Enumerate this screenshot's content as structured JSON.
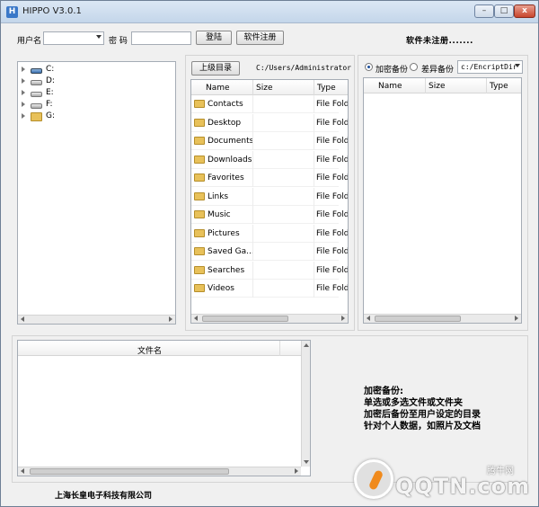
{
  "window": {
    "title": "HIPPO  V3.0.1",
    "buttons": {
      "min": "–",
      "max": "□",
      "close": "x"
    }
  },
  "toolbar": {
    "username_label": "用户名",
    "password_label": "密 码",
    "login_button": "登陆",
    "register_button": "软件注册",
    "status_text": "软件未注册......."
  },
  "drives": [
    {
      "label": "C:"
    },
    {
      "label": "D:"
    },
    {
      "label": "E:"
    },
    {
      "label": "F:"
    },
    {
      "label": "G:"
    }
  ],
  "browser": {
    "up_button": "上级目录",
    "path": "C:/Users/Administrator",
    "columns": [
      "Name",
      "Size",
      "Type"
    ],
    "rows": [
      {
        "name": "Contacts",
        "size": "",
        "type": "File Folder"
      },
      {
        "name": "Desktop",
        "size": "",
        "type": "File Folder"
      },
      {
        "name": "Documents",
        "size": "",
        "type": "File Folder"
      },
      {
        "name": "Downloads",
        "size": "",
        "type": "File Folder"
      },
      {
        "name": "Favorites",
        "size": "",
        "type": "File Folder"
      },
      {
        "name": "Links",
        "size": "",
        "type": "File Folder"
      },
      {
        "name": "Music",
        "size": "",
        "type": "File Folder"
      },
      {
        "name": "Pictures",
        "size": "",
        "type": "File Folder"
      },
      {
        "name": "Saved Ga...",
        "size": "",
        "type": "File Folder"
      },
      {
        "name": "Searches",
        "size": "",
        "type": "File Folder"
      },
      {
        "name": "Videos",
        "size": "",
        "type": "File Folder"
      }
    ]
  },
  "backup": {
    "radio_encrypt": "加密备份",
    "radio_diff": "差异备份",
    "target_dir": "c:/EncriptDir",
    "columns": [
      "Name",
      "Size",
      "Type"
    ]
  },
  "files": {
    "column": "文件名"
  },
  "info": {
    "lines": [
      "加密备份:",
      "单选或多选文件或文件夹",
      "加密后备份至用户设定的目录",
      "针对个人数据，如照片及文档"
    ]
  },
  "footer": {
    "company": "上海长皇电子科技有限公司"
  },
  "watermark": {
    "logo_text": "QQTN.com",
    "site_name": "腾牛网"
  }
}
